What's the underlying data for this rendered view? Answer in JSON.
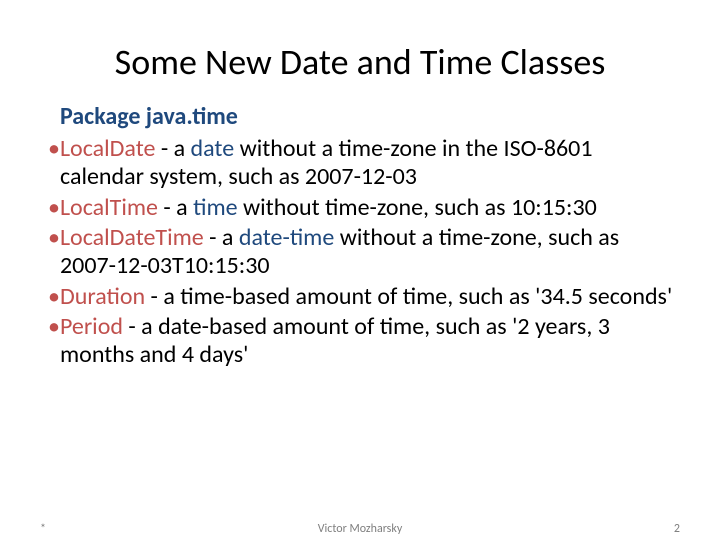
{
  "title": "Some New Date and Time Classes",
  "subtitle": "Package java.time",
  "items": [
    {
      "term": "LocalDate",
      "sep": " - a ",
      "keyword": "date",
      "rest": " without a time-zone in the ISO-8601 calendar system, such as 2007-12-03"
    },
    {
      "term": "LocalTime",
      "sep": " - a ",
      "keyword": "time",
      "rest": " without time-zone, such as 10:15:30"
    },
    {
      "term": "LocalDateTime",
      "sep": " - a ",
      "keyword": "date-time",
      "rest": " without a time-zone, such as 2007-12-03T10:15:30"
    },
    {
      "term": "Duration",
      "sep": " - a time-based amount of time, such as '34.5 seconds'",
      "keyword": "",
      "rest": ""
    },
    {
      "term": "Period",
      "sep": " - a date-based amount of time, such as '2 years, 3 months and 4 days'",
      "keyword": "",
      "rest": ""
    }
  ],
  "footer": {
    "asterisk": "*",
    "author": "Victor Mozharsky",
    "page": "2"
  }
}
